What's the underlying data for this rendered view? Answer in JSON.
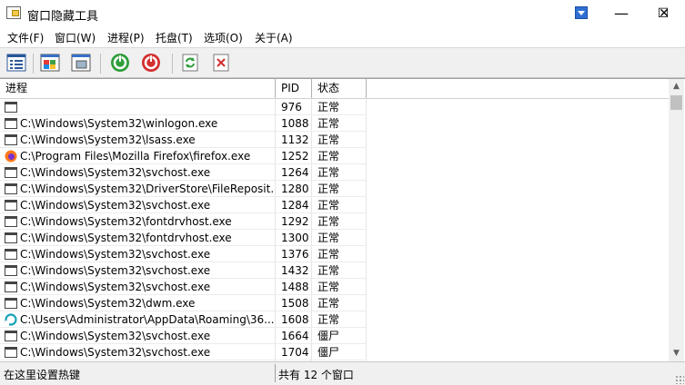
{
  "window": {
    "title": "窗口隐藏工具",
    "minimize_glyph": "—",
    "maximize_glyph": "☐",
    "close_glyph": "✕"
  },
  "menu": [
    "文件(F)",
    "窗口(W)",
    "进程(P)",
    "托盘(T)",
    "选项(O)",
    "关于(A)"
  ],
  "toolbar": {
    "icons": [
      "list-view-icon",
      "window-layout-icon",
      "window-hide-icon",
      "start-green-icon",
      "stop-red-icon",
      "refresh-icon",
      "delete-icon"
    ]
  },
  "table": {
    "columns": [
      "进程",
      "PID",
      "状态"
    ],
    "rows": [
      {
        "icon": "window",
        "process": "",
        "pid": "976",
        "state": "正常"
      },
      {
        "icon": "window",
        "process": "C:\\Windows\\System32\\winlogon.exe",
        "pid": "1088",
        "state": "正常"
      },
      {
        "icon": "window",
        "process": "C:\\Windows\\System32\\lsass.exe",
        "pid": "1132",
        "state": "正常"
      },
      {
        "icon": "firefox",
        "process": "C:\\Program Files\\Mozilla Firefox\\firefox.exe",
        "pid": "1252",
        "state": "正常"
      },
      {
        "icon": "window",
        "process": "C:\\Windows\\System32\\svchost.exe",
        "pid": "1264",
        "state": "正常"
      },
      {
        "icon": "window",
        "process": "C:\\Windows\\System32\\DriverStore\\FileReposit...",
        "pid": "1280",
        "state": "正常"
      },
      {
        "icon": "window",
        "process": "C:\\Windows\\System32\\svchost.exe",
        "pid": "1284",
        "state": "正常"
      },
      {
        "icon": "window",
        "process": "C:\\Windows\\System32\\fontdrvhost.exe",
        "pid": "1292",
        "state": "正常"
      },
      {
        "icon": "window",
        "process": "C:\\Windows\\System32\\fontdrvhost.exe",
        "pid": "1300",
        "state": "正常"
      },
      {
        "icon": "window",
        "process": "C:\\Windows\\System32\\svchost.exe",
        "pid": "1376",
        "state": "正常"
      },
      {
        "icon": "window",
        "process": "C:\\Windows\\System32\\svchost.exe",
        "pid": "1432",
        "state": "正常"
      },
      {
        "icon": "window",
        "process": "C:\\Windows\\System32\\svchost.exe",
        "pid": "1488",
        "state": "正常"
      },
      {
        "icon": "window",
        "process": "C:\\Windows\\System32\\dwm.exe",
        "pid": "1508",
        "state": "正常"
      },
      {
        "icon": "teal",
        "process": "C:\\Users\\Administrator\\AppData\\Roaming\\36...",
        "pid": "1608",
        "state": "正常"
      },
      {
        "icon": "window",
        "process": "C:\\Windows\\System32\\svchost.exe",
        "pid": "1664",
        "state": "僵尸"
      },
      {
        "icon": "window",
        "process": "C:\\Windows\\System32\\svchost.exe",
        "pid": "1704",
        "state": "僵尸"
      }
    ]
  },
  "scrollbar": {
    "up": "▲",
    "down": "▼"
  },
  "status": {
    "left": "在这里设置热键",
    "right": "共有 12 个窗口"
  }
}
